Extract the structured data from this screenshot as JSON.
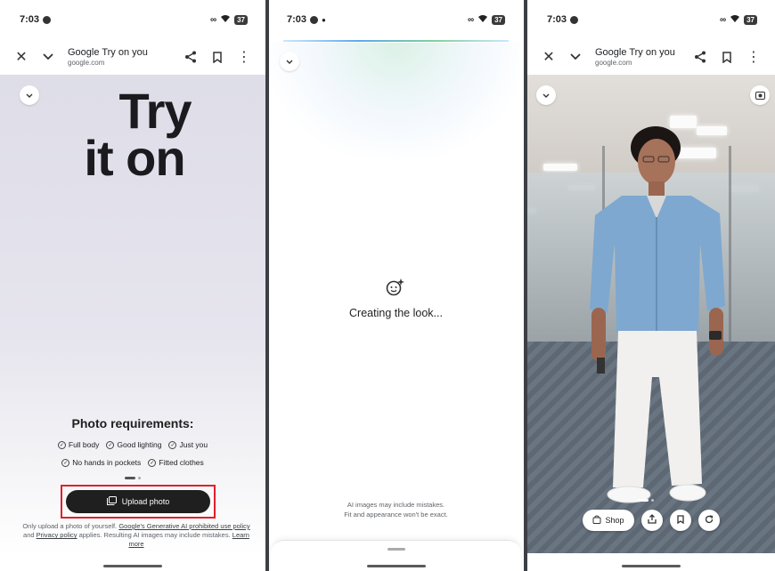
{
  "status": {
    "time": "7:03",
    "battery": "37"
  },
  "browser": {
    "title": "Google Try on you",
    "url": "google.com"
  },
  "intro": {
    "hero_line1": "Try",
    "hero_line2": "it on",
    "requirements_title": "Photo requirements:",
    "requirements_row1": [
      "Full body",
      "Good lighting",
      "Just you"
    ],
    "requirements_row2": [
      "No hands in pockets",
      "Fitted clothes"
    ],
    "upload_label": "Upload photo",
    "disclaimer_1": "Only upload a photo of yourself.",
    "disclaimer_link_1": "Google's Generative AI prohibited use policy",
    "disclaimer_2": "and",
    "disclaimer_link_2": "Privacy policy",
    "disclaimer_3": "applies. Resulting AI images may include mistakes.",
    "disclaimer_link_3": "Learn more"
  },
  "loading": {
    "message": "Creating the look...",
    "note_line1": "AI images may include mistakes.",
    "note_line2": "Fit and appearance won't be exact."
  },
  "result": {
    "shop_label": "Shop"
  },
  "colors": {
    "upload_highlight": "#e0202a",
    "upload_button": "#1f1f1f"
  }
}
